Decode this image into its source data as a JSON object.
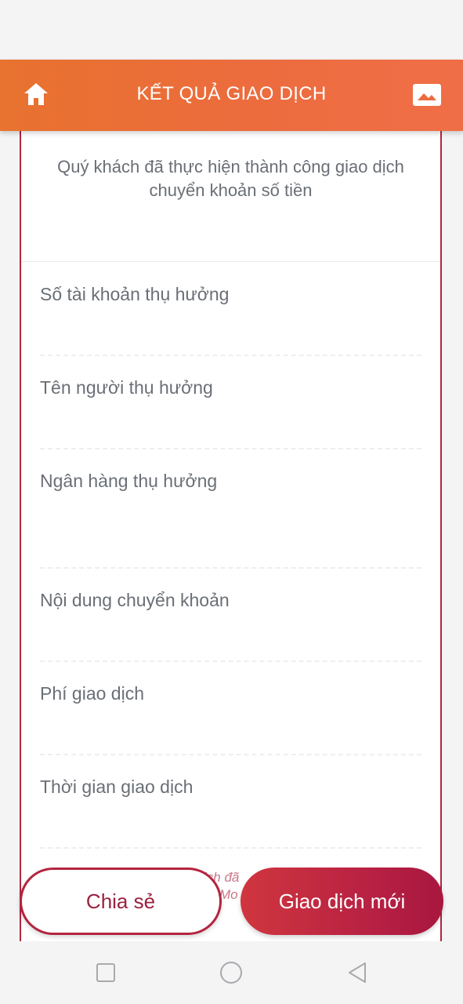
{
  "header": {
    "title": "KẾT QUẢ GIAO DỊCH",
    "home_icon": "home-icon",
    "image_icon": "image-icon"
  },
  "result": {
    "message": "Quý khách đã thực hiện thành công giao dịch chuyển khoản số tiền"
  },
  "fields": [
    {
      "label": "Số tài khoản thụ hưởng"
    },
    {
      "label": "Tên người thụ hưởng"
    },
    {
      "label": "Ngân hàng thụ hưởng"
    },
    {
      "label": "Nội dung chuyển khoản"
    },
    {
      "label": "Phí giao dịch"
    },
    {
      "label": "Thời gian giao dịch"
    }
  ],
  "footer": {
    "ghost_line1": "ịch đã",
    "ghost_line2": "Mo",
    "share_label": "Chia sẻ",
    "new_transaction_label": "Giao dịch mới"
  },
  "navbar": {
    "recents_icon": "square-icon",
    "home_icon": "circle-icon",
    "back_icon": "triangle-back-icon"
  },
  "colors": {
    "header_start": "#e8722f",
    "header_end": "#f06e47",
    "accent": "#b3253f",
    "text_gray": "#6a6f76"
  }
}
